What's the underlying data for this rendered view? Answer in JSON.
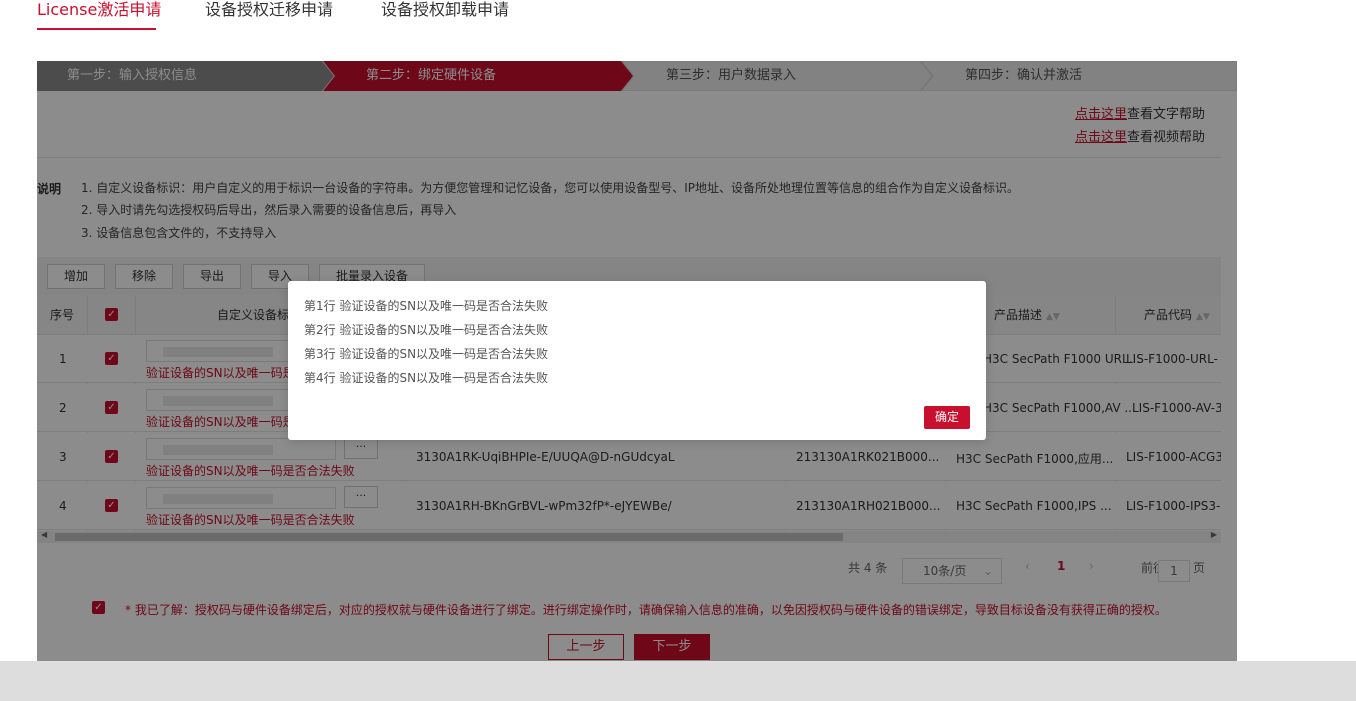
{
  "tabs": [
    "License激活申请",
    "设备授权迁移申请",
    "设备授权卸载申请"
  ],
  "steps": [
    "第一步：输入授权信息",
    "第二步：绑定硬件设备",
    "第三步：用户数据录入",
    "第四步：确认并激活"
  ],
  "help": {
    "link": "点击这里",
    "text_help": "查看文字帮助",
    "video_help": "查看视频帮助"
  },
  "description": {
    "title": "说明",
    "lines": [
      "1. 自定义设备标识：用户自定义的用于标识一台设备的字符串。为方便您管理和记忆设备，您可以使用设备型号、IP地址、设备所处地理位置等信息的组合作为自定义设备标识。",
      "2. 导入时请先勾选授权码后导出，然后录入需要的设备信息后，再导入",
      "3. 设备信息包含文件的，不支持导入"
    ]
  },
  "toolbar": [
    "增加",
    "移除",
    "导出",
    "导入",
    "批量录入设备"
  ],
  "table": {
    "headers": {
      "index": "序号",
      "custom_id": "自定义设备标识",
      "product_desc": "产品描述",
      "product_code": "产品代码"
    },
    "error_text": "验证设备的SN以及唯一码是否合法失败",
    "more_label": "···",
    "rows": [
      {
        "index": "1",
        "desc": "H3C SecPath F1000 URL...",
        "code": "LIS-F1000-URL-"
      },
      {
        "index": "2",
        "desc": "H3C SecPath F1000,AV ...",
        "code": "LIS-F1000-AV-3"
      },
      {
        "index": "3",
        "serial": "3130A1RK-UqiBHPIe-E/UUQA@D-nGUdcyaL",
        "device": "213130A1RK021B000...",
        "desc": "H3C SecPath F1000,应用...",
        "code": "LIS-F1000-ACG3"
      },
      {
        "index": "4",
        "serial": "3130A1RH-BKnGrBVL-wPm32fP*-eJYEWBe/",
        "device": "213130A1RH021B000...",
        "desc": "H3C SecPath F1000,IPS ...",
        "code": "LIS-F1000-IPS3-"
      }
    ]
  },
  "pager": {
    "total": "共 4 条",
    "page_size": "10条/页",
    "current": "1",
    "goto_label": "前往",
    "goto_value": "1",
    "page_unit": "页"
  },
  "agreement": "* 我已了解：授权码与硬件设备绑定后，对应的授权就与硬件设备进行了绑定。进行绑定操作时，请确保输入信息的准确，以免因授权码与硬件设备的错误绑定，导致目标设备没有获得正确的授权。",
  "buttons": {
    "prev": "上一步",
    "next": "下一步"
  },
  "modal": {
    "lines": [
      "第1行 验证设备的SN以及唯一码是否合法失败",
      "第2行 验证设备的SN以及唯一码是否合法失败",
      "第3行 验证设备的SN以及唯一码是否合法失败",
      "第4行 验证设备的SN以及唯一码是否合法失败"
    ],
    "ok": "确定"
  },
  "colors": {
    "accent": "#c8102e",
    "step_done": "#8a8a8a"
  }
}
